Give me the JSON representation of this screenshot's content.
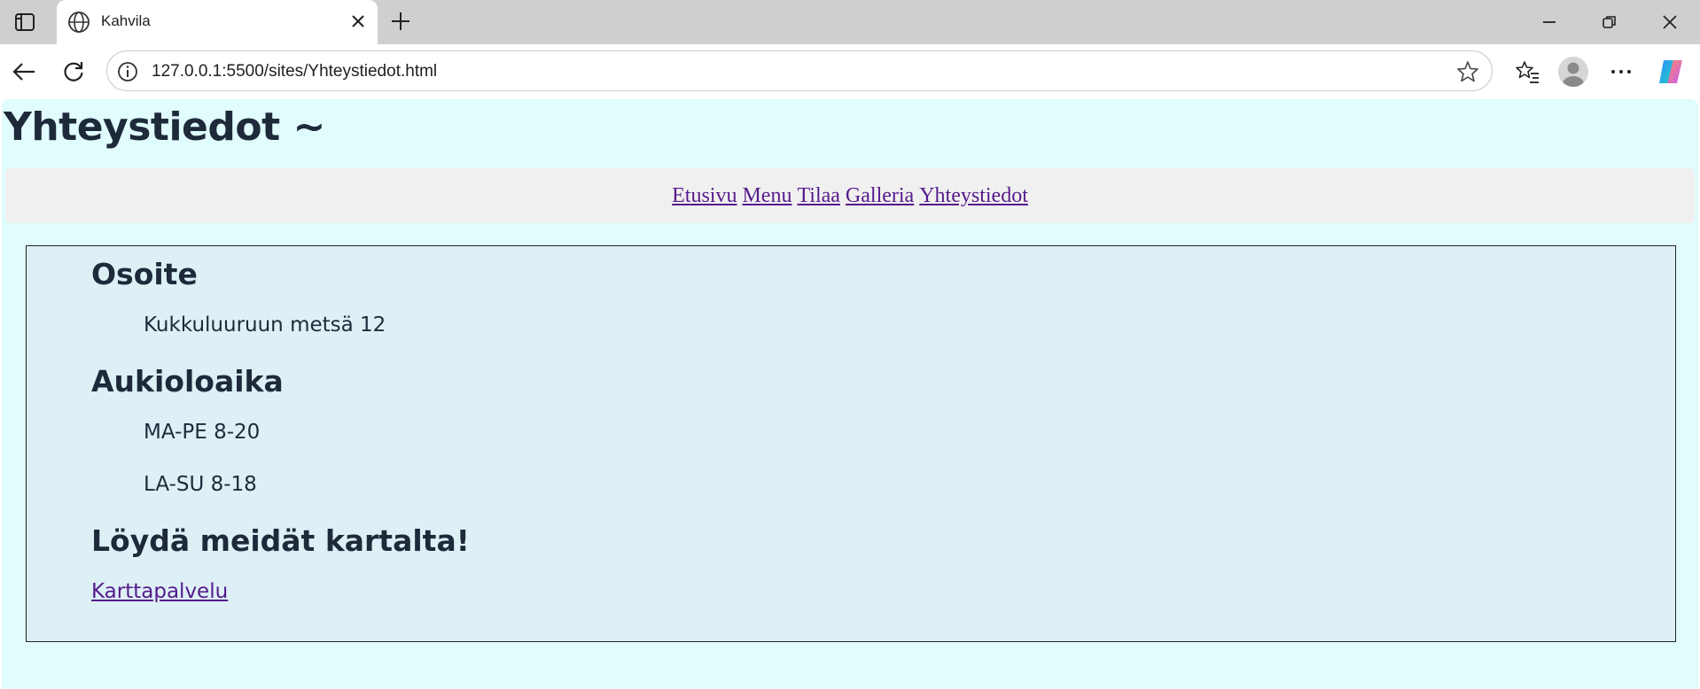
{
  "browser": {
    "tab_title": "Kahvila",
    "url": "127.0.0.1:5500/sites/Yhteystiedot.html"
  },
  "page": {
    "title": "Yhteystiedot ~",
    "nav": {
      "items": [
        "Etusivu",
        "Menu",
        "Tilaa",
        "Galleria",
        "Yhteystiedot"
      ]
    },
    "address": {
      "heading": "Osoite",
      "street": "Kukkuluuruun metsä 12"
    },
    "hours": {
      "heading": "Aukioloaika",
      "weekdays": "MA-PE 8-20",
      "weekend": "LA-SU 8-18"
    },
    "map": {
      "heading": "Löydä meidät kartalta!",
      "link": "Karttapalvelu"
    }
  },
  "colors": {
    "page_background": "#e0fcfc",
    "nav_background": "#f0f0f0",
    "box_background": "#ddf0f6",
    "link_color": "#551a8b",
    "text_color": "#1e2a3a"
  }
}
